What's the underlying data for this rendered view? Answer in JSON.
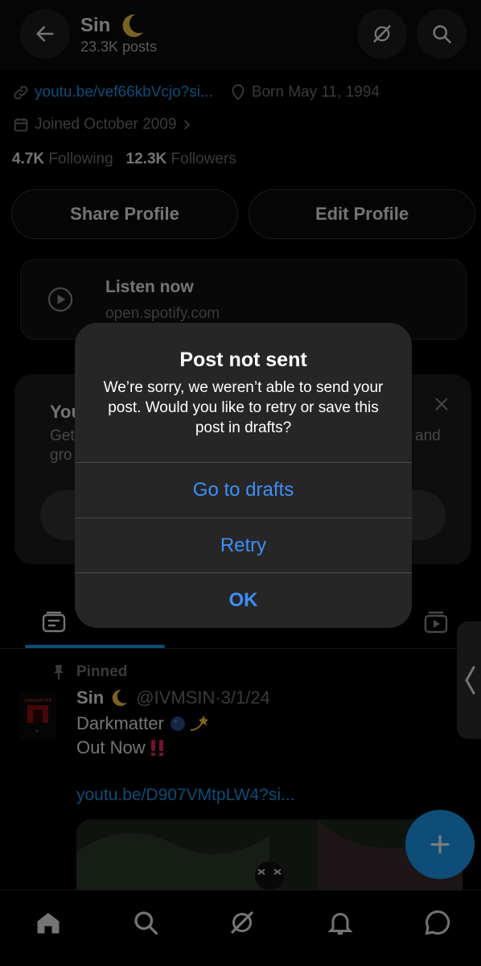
{
  "header": {
    "name": "Sin",
    "posts_count": "23.3K posts"
  },
  "profile": {
    "link": "youtu.be/vef66kbVcjo?si...",
    "birthday": "Born May 11, 1994",
    "joined": "Joined October 2009",
    "following_count": "4.7K",
    "following_label": "Following",
    "followers_count": "12.3K",
    "followers_label": "Followers",
    "share_label": "Share Profile",
    "edit_label": "Edit Profile"
  },
  "spotify": {
    "title": "Listen now",
    "subtitle": "open.spotify.com"
  },
  "promo": {
    "title_visible": "You",
    "line1_visible": "Get",
    "line2_visible": "gro",
    "line1_end_visible": "and"
  },
  "pinned": {
    "label": "Pinned",
    "author": "Sin",
    "handle": "@IVMSIN",
    "date": "3/1/24",
    "line1": "Darkmatter",
    "line2": "Out Now",
    "link": "youtu.be/D907VMtpLW4?si...",
    "avatar_text": "DARKMATTER"
  },
  "dialog": {
    "title": "Post not sent",
    "message": "We’re sorry, we weren’t able to send your post. Would you like to retry or save this post in drafts?",
    "drafts_label": "Go to drafts",
    "retry_label": "Retry",
    "ok_label": "OK"
  },
  "colors": {
    "accent": "#1d9bf0",
    "ios_blue": "#3e8ef7",
    "dialog_bg": "#262626"
  },
  "icons": [
    "back-arrow-icon",
    "grok-icon",
    "search-icon",
    "link-icon",
    "location-icon",
    "calendar-icon",
    "chevron-right-icon",
    "play-icon",
    "close-icon",
    "pin-icon",
    "home-icon",
    "notifications-icon",
    "messages-icon",
    "plus-icon"
  ]
}
